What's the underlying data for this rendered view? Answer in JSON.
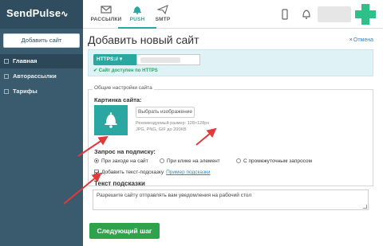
{
  "brand": {
    "name": "SendPulse",
    "pulse_glyph": "∿",
    "accent": "#2aa7a1",
    "sidebar_bg": "#3a5a6d"
  },
  "topnav": {
    "tabs": [
      {
        "label": "РАССЫЛКИ",
        "icon": "envelope-icon",
        "active": false
      },
      {
        "label": "PUSH",
        "icon": "bell-icon",
        "active": true
      },
      {
        "label": "SMTP",
        "icon": "paper-plane-icon",
        "active": false
      }
    ]
  },
  "sidebar": {
    "add_site_label": "Добавить сайт",
    "items": [
      {
        "label": "Главная",
        "active": true
      },
      {
        "label": "Авторассылки",
        "active": false
      },
      {
        "label": "Тарифы",
        "active": false
      }
    ]
  },
  "main": {
    "title": "Добавить новый сайт",
    "cancel_label": "Отмена",
    "protocol_label": "HTTPS:// ▾",
    "https_status": "Сайт доступен по HTTPS",
    "general_settings_legend": "Общие настройки сайта",
    "site_image_label": "Картинка сайта:",
    "choose_image_label": "Выбрать изображение",
    "recommended_size": "Рекомендуемый размер: 128×128px",
    "formats": "JPG, PNG, GIF до 200KB",
    "subscription_request_label": "Запрос на подписку:",
    "radio_options": [
      {
        "label": "При заходе на сайт",
        "selected": true
      },
      {
        "label": "При клике на элемент",
        "selected": false
      },
      {
        "label": "С промежуточным запросом",
        "selected": false
      }
    ],
    "add_hint_label": "Добавить текст-подсказку",
    "hint_example_link": "Пример подсказки",
    "hint_text_title": "Текст подсказки",
    "hint_text_value": "Разрешите сайту  отправлять вам уведомления на рабочий стол",
    "next_step_label": "Следующий шаг",
    "next_button_color": "#2fa34c",
    "annotation_arrow_color": "#e03a3a"
  }
}
